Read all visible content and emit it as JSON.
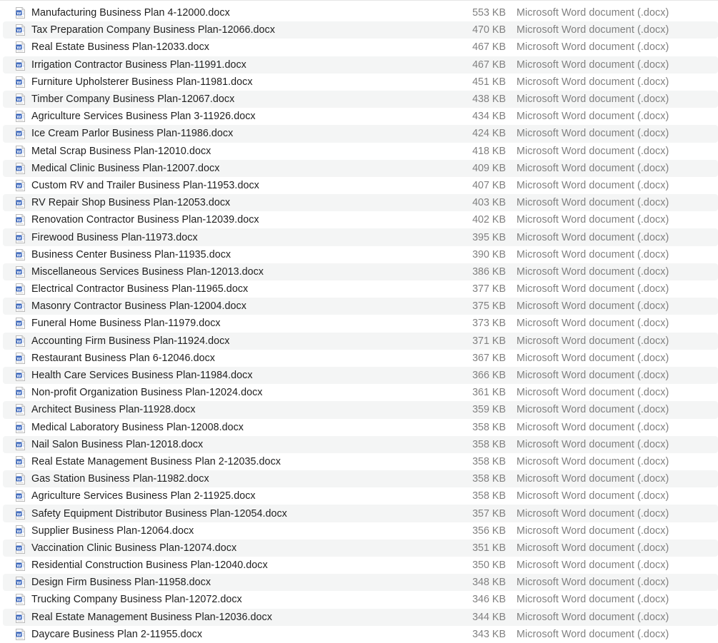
{
  "colors": {
    "stripe": "#f4f5f5",
    "name_text": "#1f1f1f",
    "meta_text": "#808080",
    "word_icon_blue": "#2b5bb8"
  },
  "files": [
    {
      "name": "Manufacturing Business Plan 4-12000.docx",
      "size": "553 KB",
      "kind": "Microsoft Word document (.docx)",
      "icon": "word-document-icon"
    },
    {
      "name": "Tax Preparation Company Business Plan-12066.docx",
      "size": "470 KB",
      "kind": "Microsoft Word document (.docx)",
      "icon": "word-document-icon"
    },
    {
      "name": "Real Estate Business Plan-12033.docx",
      "size": "467 KB",
      "kind": "Microsoft Word document (.docx)",
      "icon": "word-document-icon"
    },
    {
      "name": "Irrigation Contractor Business Plan-11991.docx",
      "size": "467 KB",
      "kind": "Microsoft Word document (.docx)",
      "icon": "word-document-icon"
    },
    {
      "name": "Furniture Upholsterer Business Plan-11981.docx",
      "size": "451 KB",
      "kind": "Microsoft Word document (.docx)",
      "icon": "word-document-icon"
    },
    {
      "name": "Timber Company Business Plan-12067.docx",
      "size": "438 KB",
      "kind": "Microsoft Word document (.docx)",
      "icon": "word-document-icon"
    },
    {
      "name": "Agriculture Services Business Plan 3-11926.docx",
      "size": "434 KB",
      "kind": "Microsoft Word document (.docx)",
      "icon": "word-document-icon"
    },
    {
      "name": "Ice Cream Parlor Business Plan-11986.docx",
      "size": "424 KB",
      "kind": "Microsoft Word document (.docx)",
      "icon": "word-document-icon"
    },
    {
      "name": "Metal Scrap Business Plan-12010.docx",
      "size": "418 KB",
      "kind": "Microsoft Word document (.docx)",
      "icon": "word-document-icon"
    },
    {
      "name": "Medical Clinic Business Plan-12007.docx",
      "size": "409 KB",
      "kind": "Microsoft Word document (.docx)",
      "icon": "word-document-icon"
    },
    {
      "name": "Custom RV and Trailer Business Plan-11953.docx",
      "size": "407 KB",
      "kind": "Microsoft Word document (.docx)",
      "icon": "word-document-icon"
    },
    {
      "name": "RV Repair Shop Business Plan-12053.docx",
      "size": "403 KB",
      "kind": "Microsoft Word document (.docx)",
      "icon": "word-document-icon"
    },
    {
      "name": "Renovation Contractor Business Plan-12039.docx",
      "size": "402 KB",
      "kind": "Microsoft Word document (.docx)",
      "icon": "word-document-icon"
    },
    {
      "name": "Firewood Business Plan-11973.docx",
      "size": "395 KB",
      "kind": "Microsoft Word document (.docx)",
      "icon": "word-document-icon"
    },
    {
      "name": "Business Center Business Plan-11935.docx",
      "size": "390 KB",
      "kind": "Microsoft Word document (.docx)",
      "icon": "word-document-icon"
    },
    {
      "name": "Miscellaneous Services Business Plan-12013.docx",
      "size": "386 KB",
      "kind": "Microsoft Word document (.docx)",
      "icon": "word-document-icon"
    },
    {
      "name": "Electrical Contractor Business Plan-11965.docx",
      "size": "377 KB",
      "kind": "Microsoft Word document (.docx)",
      "icon": "word-document-icon"
    },
    {
      "name": "Masonry Contractor Business Plan-12004.docx",
      "size": "375 KB",
      "kind": "Microsoft Word document (.docx)",
      "icon": "word-document-icon"
    },
    {
      "name": "Funeral Home Business Plan-11979.docx",
      "size": "373 KB",
      "kind": "Microsoft Word document (.docx)",
      "icon": "word-document-icon"
    },
    {
      "name": "Accounting Firm Business Plan-11924.docx",
      "size": "371 KB",
      "kind": "Microsoft Word document (.docx)",
      "icon": "word-document-icon"
    },
    {
      "name": "Restaurant Business Plan 6-12046.docx",
      "size": "367 KB",
      "kind": "Microsoft Word document (.docx)",
      "icon": "word-document-icon"
    },
    {
      "name": "Health Care Services Business Plan-11984.docx",
      "size": "366 KB",
      "kind": "Microsoft Word document (.docx)",
      "icon": "word-document-icon"
    },
    {
      "name": "Non-profit Organization Business Plan-12024.docx",
      "size": "361 KB",
      "kind": "Microsoft Word document (.docx)",
      "icon": "word-document-icon"
    },
    {
      "name": "Architect Business Plan-11928.docx",
      "size": "359 KB",
      "kind": "Microsoft Word document (.docx)",
      "icon": "word-document-icon"
    },
    {
      "name": "Medical Laboratory Business Plan-12008.docx",
      "size": "358 KB",
      "kind": "Microsoft Word document (.docx)",
      "icon": "word-document-icon"
    },
    {
      "name": "Nail Salon Business Plan-12018.docx",
      "size": "358 KB",
      "kind": "Microsoft Word document (.docx)",
      "icon": "word-document-icon"
    },
    {
      "name": "Real Estate Management Business Plan 2-12035.docx",
      "size": "358 KB",
      "kind": "Microsoft Word document (.docx)",
      "icon": "word-document-icon"
    },
    {
      "name": "Gas Station Business Plan-11982.docx",
      "size": "358 KB",
      "kind": "Microsoft Word document (.docx)",
      "icon": "word-document-icon"
    },
    {
      "name": "Agriculture Services Business Plan 2-11925.docx",
      "size": "358 KB",
      "kind": "Microsoft Word document (.docx)",
      "icon": "word-document-icon"
    },
    {
      "name": "Safety Equipment Distributor Business Plan-12054.docx",
      "size": "357 KB",
      "kind": "Microsoft Word document (.docx)",
      "icon": "word-document-icon"
    },
    {
      "name": "Supplier Business Plan-12064.docx",
      "size": "356 KB",
      "kind": "Microsoft Word document (.docx)",
      "icon": "word-document-icon"
    },
    {
      "name": "Vaccination Clinic Business Plan-12074.docx",
      "size": "351 KB",
      "kind": "Microsoft Word document (.docx)",
      "icon": "word-document-icon"
    },
    {
      "name": "Residential Construction Business Plan-12040.docx",
      "size": "350 KB",
      "kind": "Microsoft Word document (.docx)",
      "icon": "word-document-icon"
    },
    {
      "name": "Design Firm Business Plan-11958.docx",
      "size": "348 KB",
      "kind": "Microsoft Word document (.docx)",
      "icon": "word-document-icon"
    },
    {
      "name": "Trucking Company Business Plan-12072.docx",
      "size": "346 KB",
      "kind": "Microsoft Word document (.docx)",
      "icon": "word-document-icon"
    },
    {
      "name": "Real Estate Management Business Plan-12036.docx",
      "size": "344 KB",
      "kind": "Microsoft Word document (.docx)",
      "icon": "word-document-icon"
    },
    {
      "name": "Daycare Business Plan 2-11955.docx",
      "size": "343 KB",
      "kind": "Microsoft Word document (.docx)",
      "icon": "word-document-icon"
    }
  ]
}
